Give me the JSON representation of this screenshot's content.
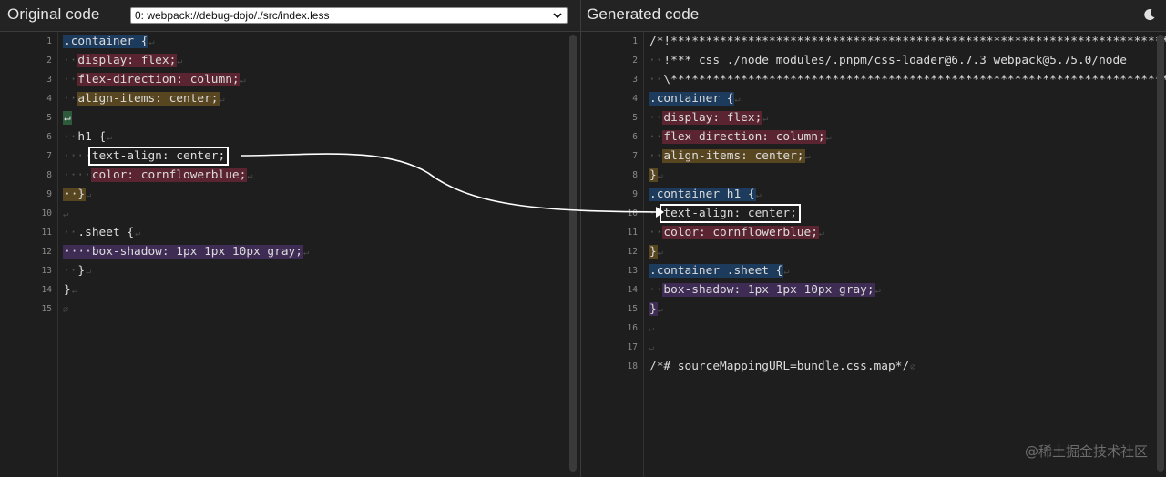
{
  "left": {
    "title": "Original code",
    "file_select_value": "0: webpack://debug-dojo/./src/index.less",
    "lines": [
      {
        "n": "1",
        "indent": "",
        "segs": [
          {
            "t": ".container {",
            "c": "blue"
          }
        ],
        "end": "↵"
      },
      {
        "n": "2",
        "indent": "··",
        "segs": [
          {
            "t": "display: flex;",
            "c": "red"
          }
        ],
        "end": "↵"
      },
      {
        "n": "3",
        "indent": "··",
        "segs": [
          {
            "t": "flex-direction: column;",
            "c": "red"
          }
        ],
        "end": "↵"
      },
      {
        "n": "4",
        "indent": "··",
        "segs": [
          {
            "t": "align-items: center;",
            "c": "gold"
          }
        ],
        "end": "↵"
      },
      {
        "n": "5",
        "indent": "",
        "segs": [
          {
            "t": "↵",
            "c": "green"
          }
        ],
        "end": ""
      },
      {
        "n": "6",
        "indent": "··",
        "segs": [
          {
            "t": "h1 {",
            "c": ""
          }
        ],
        "end": "↵"
      },
      {
        "n": "7",
        "indent": "····",
        "segs": [
          {
            "t": "text-align: center;",
            "c": "box"
          }
        ],
        "end": ""
      },
      {
        "n": "8",
        "indent": "····",
        "segs": [
          {
            "t": "color: cornflowerblue;",
            "c": "red"
          }
        ],
        "end": "↵"
      },
      {
        "n": "9",
        "indent": "",
        "segs": [
          {
            "t": "··}",
            "c": "gold"
          }
        ],
        "end": "↵"
      },
      {
        "n": "10",
        "indent": "",
        "segs": [],
        "end": "↵"
      },
      {
        "n": "11",
        "indent": "··",
        "segs": [
          {
            "t": ".sheet {",
            "c": ""
          }
        ],
        "end": "↵"
      },
      {
        "n": "12",
        "indent": "",
        "segs": [
          {
            "t": "····box-shadow: 1px 1px 10px gray;",
            "c": "purple"
          }
        ],
        "end": "↵"
      },
      {
        "n": "13",
        "indent": "··",
        "segs": [
          {
            "t": "}",
            "c": ""
          }
        ],
        "end": "↵"
      },
      {
        "n": "14",
        "indent": "",
        "segs": [
          {
            "t": "}",
            "c": ""
          }
        ],
        "end": "↵"
      },
      {
        "n": "15",
        "indent": "",
        "segs": [],
        "end": "∅"
      }
    ]
  },
  "right": {
    "title": "Generated code",
    "lines": [
      {
        "n": "1",
        "indent": "",
        "segs": [
          {
            "t": "/*!****************************************************************************",
            "c": ""
          }
        ],
        "end": ""
      },
      {
        "n": "2",
        "indent": "··",
        "segs": [
          {
            "t": "!*** css ./node_modules/.pnpm/css-loader@6.7.3_webpack@5.75.0/node",
            "c": ""
          }
        ],
        "end": ""
      },
      {
        "n": "3",
        "indent": "··",
        "segs": [
          {
            "t": "\\**************************************************************************",
            "c": ""
          }
        ],
        "end": ""
      },
      {
        "n": "4",
        "indent": "",
        "segs": [
          {
            "t": ".container {",
            "c": "blue"
          }
        ],
        "end": "↵"
      },
      {
        "n": "5",
        "indent": "··",
        "segs": [
          {
            "t": "display: flex;",
            "c": "red"
          }
        ],
        "end": "↵"
      },
      {
        "n": "6",
        "indent": "··",
        "segs": [
          {
            "t": "flex-direction: column;",
            "c": "red"
          }
        ],
        "end": "↵"
      },
      {
        "n": "7",
        "indent": "··",
        "segs": [
          {
            "t": "align-items: center;",
            "c": "gold"
          }
        ],
        "end": "↵"
      },
      {
        "n": "8",
        "indent": "",
        "segs": [
          {
            "t": "}",
            "c": "gold"
          }
        ],
        "end": "↵"
      },
      {
        "n": "9",
        "indent": "",
        "segs": [
          {
            "t": ".container h1 {",
            "c": "blue"
          }
        ],
        "end": "↵"
      },
      {
        "n": "10",
        "indent": "··",
        "segs": [
          {
            "t": "text-align: center;",
            "c": "box"
          }
        ],
        "end": ""
      },
      {
        "n": "11",
        "indent": "··",
        "segs": [
          {
            "t": "color: cornflowerblue;",
            "c": "red"
          }
        ],
        "end": "↵"
      },
      {
        "n": "12",
        "indent": "",
        "segs": [
          {
            "t": "}",
            "c": "gold"
          }
        ],
        "end": "↵"
      },
      {
        "n": "13",
        "indent": "",
        "segs": [
          {
            "t": ".container .sheet {",
            "c": "blue"
          }
        ],
        "end": "↵"
      },
      {
        "n": "14",
        "indent": "··",
        "segs": [
          {
            "t": "box-shadow: 1px 1px 10px gray;",
            "c": "purple"
          }
        ],
        "end": "↵"
      },
      {
        "n": "15",
        "indent": "",
        "segs": [
          {
            "t": "}",
            "c": "purple"
          }
        ],
        "end": "↵"
      },
      {
        "n": "16",
        "indent": "",
        "segs": [],
        "end": "↵"
      },
      {
        "n": "17",
        "indent": "",
        "segs": [],
        "end": "↵"
      },
      {
        "n": "18",
        "indent": "",
        "segs": [
          {
            "t": "/*# sourceMappingURL=bundle.css.map*/",
            "c": ""
          }
        ],
        "end": "∅"
      }
    ]
  },
  "watermark": "@稀土掘金技术社区",
  "icons": {
    "theme_toggle": "moon-icon",
    "select_arrow": "chevron-down-icon"
  }
}
